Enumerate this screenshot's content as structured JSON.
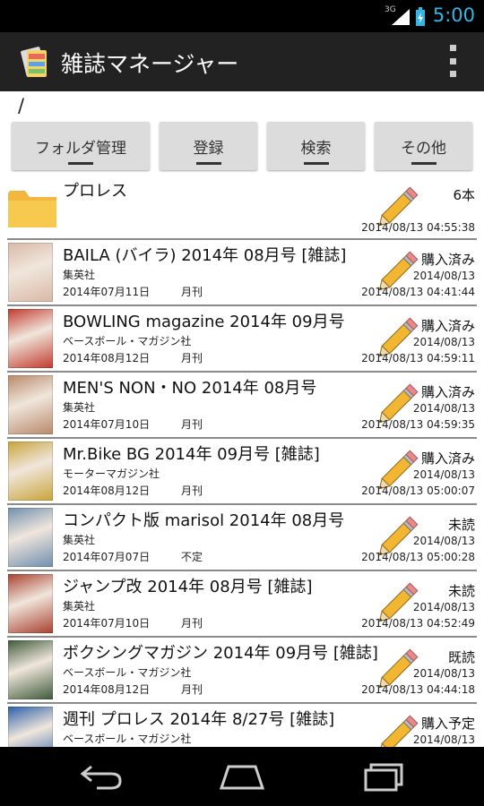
{
  "status_bar": {
    "network": "3G",
    "time": "5:00"
  },
  "app": {
    "title": "雑誌マネージャー"
  },
  "path": "/",
  "buttons": [
    {
      "label": "フォルダ管理"
    },
    {
      "label": "登録"
    },
    {
      "label": "検索"
    },
    {
      "label": "その他"
    }
  ],
  "folder": {
    "name": "プロレス",
    "count": "6本",
    "date": "2014/08/13 04:55:38"
  },
  "items": [
    {
      "title": "BAILA (バイラ) 2014年 08月号 [雑誌]",
      "publisher": "集英社",
      "release": "2014年07月11日",
      "frequency": "月刊",
      "status": "購入済み",
      "date1": "2014/08/13",
      "date2": "2014/08/13 04:41:44",
      "cover_color": "#d9b8a6"
    },
    {
      "title": "BOWLING magazine  2014年 09月号",
      "publisher": "ベースボール・マガジン社",
      "release": "2014年08月12日",
      "frequency": "月刊",
      "status": "購入済み",
      "date1": "2014/08/13",
      "date2": "2014/08/13 04:59:11",
      "cover_color": "#c23a2e"
    },
    {
      "title": "MEN'S NON・NO 2014年 08月号",
      "publisher": "集英社",
      "release": "2014年07月10日",
      "frequency": "月刊",
      "status": "購入済み",
      "date1": "2014/08/13",
      "date2": "2014/08/13 04:59:35",
      "cover_color": "#b8896a"
    },
    {
      "title": "Mr.Bike BG 2014年 09月号 [雑誌]",
      "publisher": "モーターマガジン社",
      "release": "2014年08月12日",
      "frequency": "月刊",
      "status": "購入済み",
      "date1": "2014/08/13",
      "date2": "2014/08/13 05:00:07",
      "cover_color": "#c9a43a"
    },
    {
      "title": "コンパクト版 marisol 2014年 08月号",
      "publisher": "集英社",
      "release": "2014年07月07日",
      "frequency": "不定",
      "status": "未読",
      "date1": "2014/08/13",
      "date2": "2014/08/13 05:00:28",
      "cover_color": "#6f8fae"
    },
    {
      "title": "ジャンプ改 2014年 08月号 [雑誌]",
      "publisher": "集英社",
      "release": "2014年07月10日",
      "frequency": "月刊",
      "status": "未読",
      "date1": "2014/08/13",
      "date2": "2014/08/13 04:52:49",
      "cover_color": "#a8402f"
    },
    {
      "title": "ボクシングマガジン 2014年 09月号 [雑誌]",
      "publisher": "ベースボール・マガジン社",
      "release": "2014年08月12日",
      "frequency": "月刊",
      "status": "既読",
      "date1": "2014/08/13",
      "date2": "2014/08/13 04:44:18",
      "cover_color": "#3e5a3a"
    },
    {
      "title": "週刊 プロレス 2014年 8/27号 [雑誌]",
      "publisher": "ベースボール・マガジン社",
      "release": "",
      "frequency": "",
      "status": "購入予定",
      "date1": "2014/08/13",
      "date2": "",
      "cover_color": "#2b5fa8"
    }
  ],
  "colors": {
    "accent": "#33b5e5",
    "actionbar": "#222222",
    "button": "#dcdcdc",
    "pencil": "#f2b632"
  }
}
